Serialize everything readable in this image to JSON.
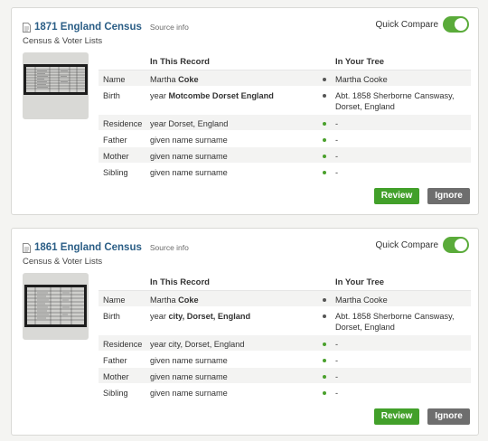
{
  "cards": [
    {
      "title": "1871 England Census",
      "source_link": "Source info",
      "subtitle": "Census & Voter Lists",
      "quick_compare": {
        "label": "Quick Compare",
        "enabled": true
      },
      "columns": {
        "record": "In This Record",
        "tree": "In Your Tree"
      },
      "rows": [
        {
          "label": "Name",
          "record_pre": "Martha ",
          "record_bold": "Coke",
          "tree": "Martha Cooke",
          "dot": "dark"
        },
        {
          "label": "Birth",
          "record_pre": "year ",
          "record_bold": "Motcombe Dorset England",
          "tree": "Abt. 1858 Sherborne Canswasy, Dorset, England",
          "dot": "dark"
        },
        {
          "label": "Residence",
          "record_pre": "year Dorset, England",
          "record_bold": "",
          "tree": "-",
          "dot": "green"
        },
        {
          "label": "Father",
          "record_pre": "given name surname",
          "record_bold": "",
          "tree": "-",
          "dot": "green"
        },
        {
          "label": "Mother",
          "record_pre": "given name surname",
          "record_bold": "",
          "tree": "-",
          "dot": "green"
        },
        {
          "label": "Sibling",
          "record_pre": "given name surname",
          "record_bold": "",
          "tree": "-",
          "dot": "green"
        }
      ],
      "review": "Review",
      "ignore": "Ignore"
    },
    {
      "title": "1861 England Census",
      "source_link": "Source info",
      "subtitle": "Census & Voter Lists",
      "quick_compare": {
        "label": "Quick Compare",
        "enabled": true
      },
      "columns": {
        "record": "In This Record",
        "tree": "In Your Tree"
      },
      "rows": [
        {
          "label": "Name",
          "record_pre": "Martha ",
          "record_bold": "Coke",
          "tree": "Martha Cooke",
          "dot": "dark"
        },
        {
          "label": "Birth",
          "record_pre": "year ",
          "record_bold": "city, Dorset, England",
          "tree": "Abt. 1858 Sherborne Canswasy, Dorset, England",
          "dot": "dark"
        },
        {
          "label": "Residence",
          "record_pre": "year city, Dorset, England",
          "record_bold": "",
          "tree": "-",
          "dot": "green"
        },
        {
          "label": "Father",
          "record_pre": "given name surname",
          "record_bold": "",
          "tree": "-",
          "dot": "green"
        },
        {
          "label": "Mother",
          "record_pre": "given name surname",
          "record_bold": "",
          "tree": "-",
          "dot": "green"
        },
        {
          "label": "Sibling",
          "record_pre": "given name surname",
          "record_bold": "",
          "tree": "-",
          "dot": "green"
        }
      ],
      "review": "Review",
      "ignore": "Ignore"
    }
  ],
  "icons": {
    "title": "document-icon",
    "thumbnail": "census-record-image"
  },
  "colors": {
    "title": "#2b5e86",
    "toggle_on": "#5aab3a",
    "review_button": "#42a02a",
    "ignore_button": "#6e6e6e",
    "match_dot": "#555555",
    "new_info_dot": "#4aa02c"
  }
}
